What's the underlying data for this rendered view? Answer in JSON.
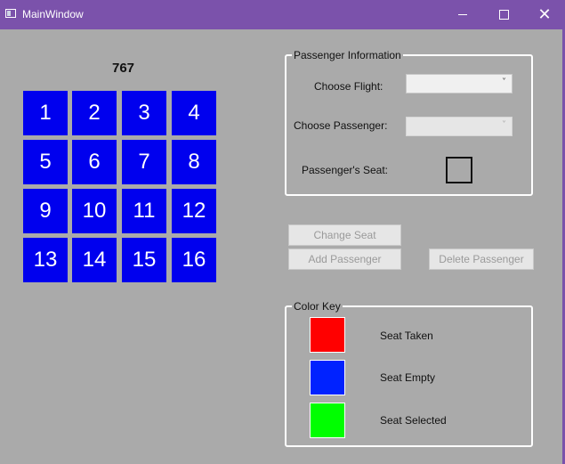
{
  "window": {
    "title": "MainWindow"
  },
  "plane": {
    "label": "767"
  },
  "seats": [
    "1",
    "2",
    "3",
    "4",
    "5",
    "6",
    "7",
    "8",
    "9",
    "10",
    "11",
    "12",
    "13",
    "14",
    "15",
    "16"
  ],
  "passenger_info": {
    "group_title": "Passenger Information",
    "choose_flight_label": "Choose Flight:",
    "choose_passenger_label": "Choose Passenger:",
    "passengers_seat_label": "Passenger's Seat:"
  },
  "buttons": {
    "change_seat": "Change Seat",
    "add_passenger": "Add Passenger",
    "delete_passenger": "Delete Passenger"
  },
  "color_key": {
    "group_title": "Color Key",
    "items": [
      {
        "label": "Seat Taken",
        "color": "#ff0000"
      },
      {
        "label": "Seat Empty",
        "color": "#0022ff"
      },
      {
        "label": "Seat Selected",
        "color": "#00ff00"
      }
    ]
  },
  "colors": {
    "seat_empty": "#0000ee",
    "titlebar": "#7b52ab"
  }
}
